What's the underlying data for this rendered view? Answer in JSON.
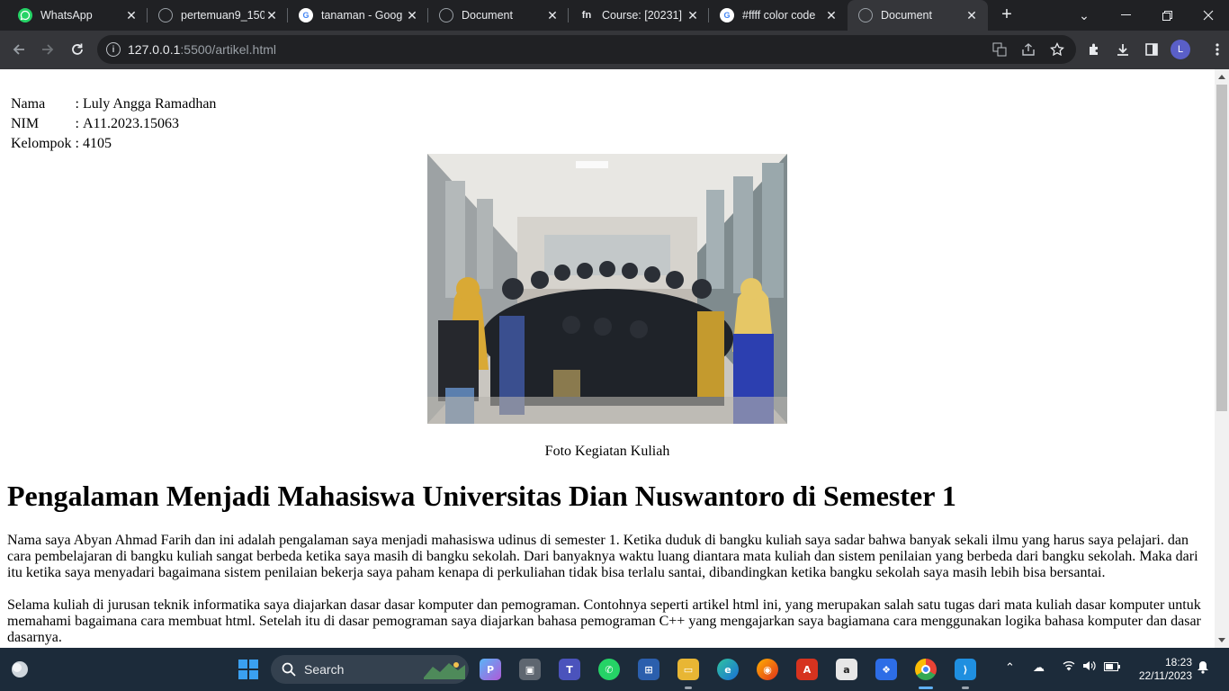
{
  "browser": {
    "tabs": [
      {
        "title": "WhatsApp",
        "icon": "whatsapp-icon",
        "color": "#25d366",
        "active": false
      },
      {
        "title": "pertemuan9_150",
        "icon": "globe-icon",
        "color": "#9aa0a6",
        "active": false
      },
      {
        "title": "tanaman - Goog",
        "icon": "google-icon",
        "color": "#ffffff",
        "active": false
      },
      {
        "title": "Document",
        "icon": "globe-icon",
        "color": "#9aa0a6",
        "active": false
      },
      {
        "title": "Course: [20231]",
        "icon": "fn-icon",
        "color": "#202124",
        "active": false
      },
      {
        "title": "#ffff color code",
        "icon": "google-icon",
        "color": "#ffffff",
        "active": false
      },
      {
        "title": "Document",
        "icon": "globe-icon",
        "color": "#9aa0a6",
        "active": true
      }
    ],
    "url_host": "127.0.0.1",
    "url_rest": ":5500/artikel.html",
    "avatar_letter": "L"
  },
  "page": {
    "identity": [
      {
        "label": "Nama",
        "sep": ":",
        "value": "Luly Angga Ramadhan"
      },
      {
        "label": "NIM",
        "sep": ":",
        "value": "A11.2023.15063"
      },
      {
        "label": "Kelompok",
        "sep": ":",
        "value": "4105"
      }
    ],
    "photo_caption": "Foto Kegiatan Kuliah",
    "heading": "Pengalaman Menjadi Mahasiswa Universitas Dian Nuswantoro di Semester 1",
    "paragraphs": [
      "Nama saya Abyan Ahmad Farih dan ini adalah pengalaman saya menjadi mahasiswa udinus di semester 1. Ketika duduk di bangku kuliah saya sadar bahwa banyak sekali ilmu yang harus saya pelajari. dan cara pembelajaran di bangku kuliah sangat berbeda ketika saya masih di bangku sekolah. Dari banyaknya waktu luang diantara mata kuliah dan sistem penilaian yang berbeda dari bangku sekolah. Maka dari itu ketika saya menyadari bagaimana sistem penilaian bekerja saya paham kenapa di perkuliahan tidak bisa terlalu santai, dibandingkan ketika bangku sekolah saya masih lebih bisa bersantai.",
      "Selama kuliah di jurusan teknik informatika saya diajarkan dasar dasar komputer dan pemograman. Contohnya seperti artikel html ini, yang merupakan salah satu tugas dari mata kuliah dasar komputer untuk memahami bagaimana cara membuat html. Setelah itu di dasar pemograman saya diajarkan bahasa pemograman C++ yang mengajarkan saya bagiamana cara menggunakan logika bahasa komputer dan dasar dasarnya."
    ]
  },
  "taskbar": {
    "search_label": "Search",
    "time": "18:23",
    "date": "22/11/2023"
  }
}
